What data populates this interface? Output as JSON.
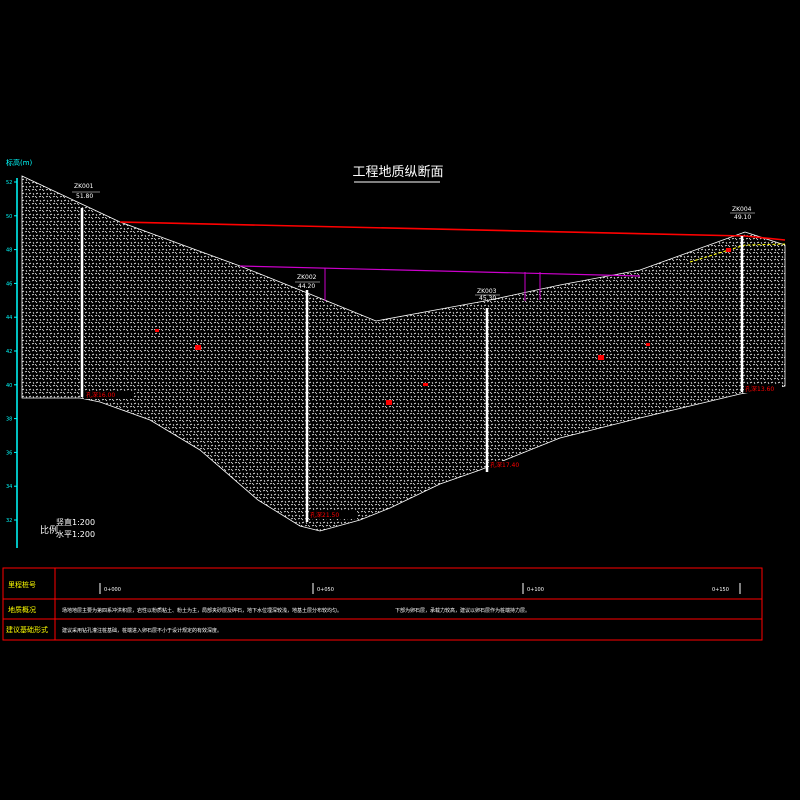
{
  "title": "工程地质纵断面",
  "axis_label": "标高(m)",
  "elevation_ticks": [
    "52",
    "50",
    "48",
    "46",
    "44",
    "42",
    "40",
    "38",
    "36",
    "34",
    "32"
  ],
  "scale": {
    "label": "比例",
    "vertical": "竖直1:200",
    "horizontal": "水平1:200"
  },
  "boreholes": [
    {
      "id": "ZK001",
      "elev": "51.80",
      "bottom": "孔深16.00"
    },
    {
      "id": "ZK002",
      "elev": "44.20",
      "bottom": "孔深21.50"
    },
    {
      "id": "ZK003",
      "elev": "45.30",
      "bottom": "孔深17.40"
    },
    {
      "id": "ZK004",
      "elev": "49.10",
      "bottom": "孔深13.60"
    }
  ],
  "table": {
    "row1_label": "里程桩号",
    "row2_label": "地质概况",
    "row3_label": "建议基础形式",
    "stations": [
      "0+000",
      "0+050",
      "0+100",
      "0+150"
    ],
    "geology": "场地地层主要为第四系冲洪积层，岩性以粉质粘土、粉土为主，局部夹砂层及碎石，地下水位埋深较浅，地基土层分布较均匀。",
    "geology_2": "下部为卵石层，承载力较高，建议以卵石层作为桩端持力层。",
    "foundation": "建议采用钻孔灌注桩基础，桩端进入卵石层不小于设计规定的有效深度。"
  },
  "colors": {
    "background": "#000000",
    "ground_line": "#ff0000",
    "water_line": "#cc00cc",
    "axis": "#00ffff",
    "table_border": "#ff0000",
    "table_text": "#ffff00",
    "table_grid": "#00ff00",
    "borehole": "#ffffff",
    "hatch": "#ffffff"
  }
}
